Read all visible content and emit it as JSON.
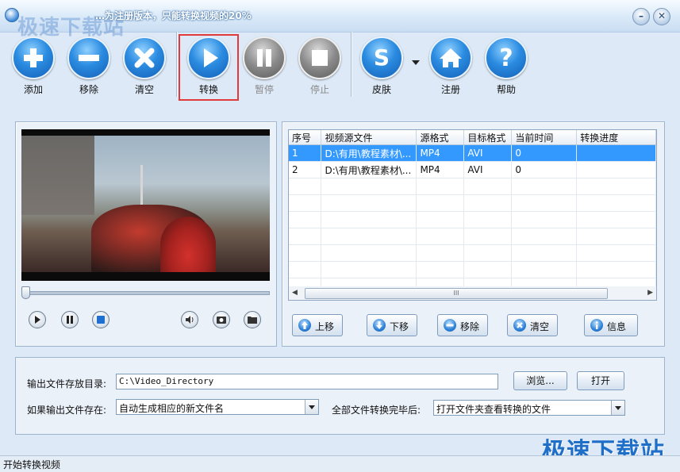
{
  "window": {
    "title": "…为注册版本，只能转换视频的20%",
    "watermark_top": "极速下载站",
    "watermark_bottom": "极速下载站"
  },
  "toolbar": {
    "add": "添加",
    "remove": "移除",
    "clear": "清空",
    "convert": "转换",
    "pause": "暂停",
    "stop": "停止",
    "skin": "皮肤",
    "register": "注册",
    "help": "帮助"
  },
  "file_table": {
    "columns": [
      "序号",
      "视频源文件",
      "源格式",
      "目标格式",
      "当前时间",
      "转换进度"
    ],
    "rows": [
      {
        "index": "1",
        "source": "D:\\有用\\教程素材\\...",
        "src_format": "MP4",
        "dst_format": "AVI",
        "time": "0",
        "progress": "",
        "selected": true
      },
      {
        "index": "2",
        "source": "D:\\有用\\教程素材\\...",
        "src_format": "MP4",
        "dst_format": "AVI",
        "time": "0",
        "progress": "",
        "selected": false
      }
    ],
    "scroll_grip": "III"
  },
  "list_buttons": {
    "up": "上移",
    "down": "下移",
    "remove": "移除",
    "clear": "清空",
    "info": "信息"
  },
  "output": {
    "dir_label": "输出文件存放目录:",
    "dir_value": "C:\\Video_Directory",
    "browse": "浏览...",
    "open": "打开",
    "exists_label": "如果输出文件存在:",
    "exists_value": "自动生成相应的新文件名",
    "after_label": "全部文件转换完毕后:",
    "after_value": "打开文件夹查看转换的文件"
  },
  "status": {
    "text": "开始转换视频"
  },
  "colors": {
    "accent": "#2a8be0",
    "highlight_box": "#e03a3a",
    "selection": "#3399ff"
  }
}
